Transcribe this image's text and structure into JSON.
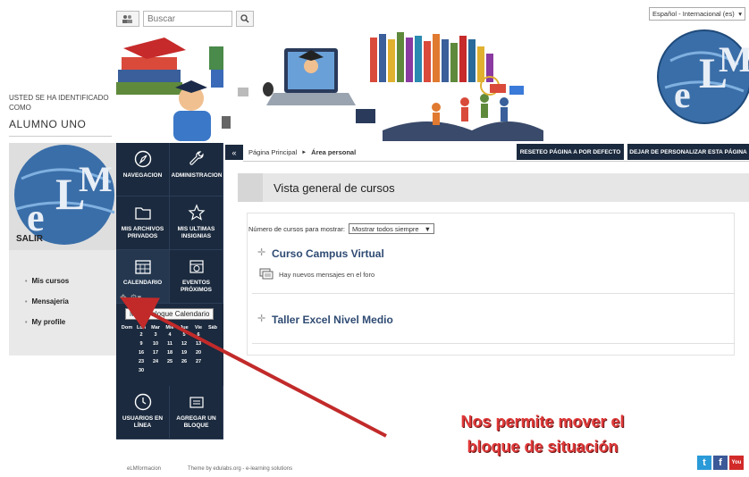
{
  "header": {
    "search_placeholder": "Buscar",
    "language": "Español - Internacional (es)"
  },
  "user": {
    "label": "USTED SE HA IDENTIFICADO COMO",
    "name": "ALUMNO UNO",
    "logout": "SALIR"
  },
  "left_links": [
    "Mis cursos",
    "Mensajería",
    "My profile"
  ],
  "nav": {
    "navegacion": "NAVEGACIÓN",
    "administracion": "ADMINISTRACIÓN",
    "archivos": "MIS ARCHIVOS PRIVADOS",
    "insignias": "MIS ÚLTIMAS INSIGNIAS",
    "calendario": "CALENDARIO",
    "eventos": "EVENTOS PRÓXIMOS",
    "usuarios": "USUARIOS EN LÍNEA",
    "agregar": "AGREGAR UN BLOQUE"
  },
  "tooltip": "Mover bloque Calendario",
  "calendar": {
    "days": [
      "Dom",
      "Lun",
      "Mar",
      "Mié",
      "Jue",
      "Vie",
      "Sáb"
    ],
    "weeks": [
      [
        "",
        "",
        "",
        "",
        "",
        "",
        ""
      ],
      [
        "",
        "2",
        "3",
        "4",
        "5",
        "6",
        ""
      ],
      [
        "",
        "9",
        "10",
        "11",
        "12",
        "13",
        ""
      ],
      [
        "",
        "16",
        "17",
        "18",
        "19",
        "20",
        ""
      ],
      [
        "",
        "23",
        "24",
        "25",
        "26",
        "27",
        ""
      ],
      [
        "",
        "30",
        "",
        "",
        "",
        "",
        ""
      ]
    ]
  },
  "breadcrumb": {
    "home": "Página Principal",
    "separator": "►",
    "current": "Área personal"
  },
  "buttons": {
    "reset": "RESETEO PÁGINA A POR DEFECTO",
    "stop": "DEJAR DE PERSONALIZAR ESTA PÁGINA"
  },
  "overview": {
    "title": "Vista general de cursos",
    "show_label": "Número de cursos para mostrar:",
    "show_value": "Mostrar todos siempre"
  },
  "courses": [
    {
      "title": "Curso Campus Virtual",
      "note": "Hay nuevos mensajes en el foro"
    },
    {
      "title": "Taller Excel Nivel Medio",
      "note": ""
    }
  ],
  "annotation": {
    "line1": "Nos permite mover el",
    "line2": "bloque de situación"
  },
  "footer": {
    "left": "eLMformacion",
    "right": "Theme by edulabs.org - e-learning solutions"
  },
  "colors": {
    "nav_bg": "#1b2a3e",
    "course_title": "#2f4b73",
    "annotation": "#e13a3a",
    "weekend": "#e2463c"
  }
}
